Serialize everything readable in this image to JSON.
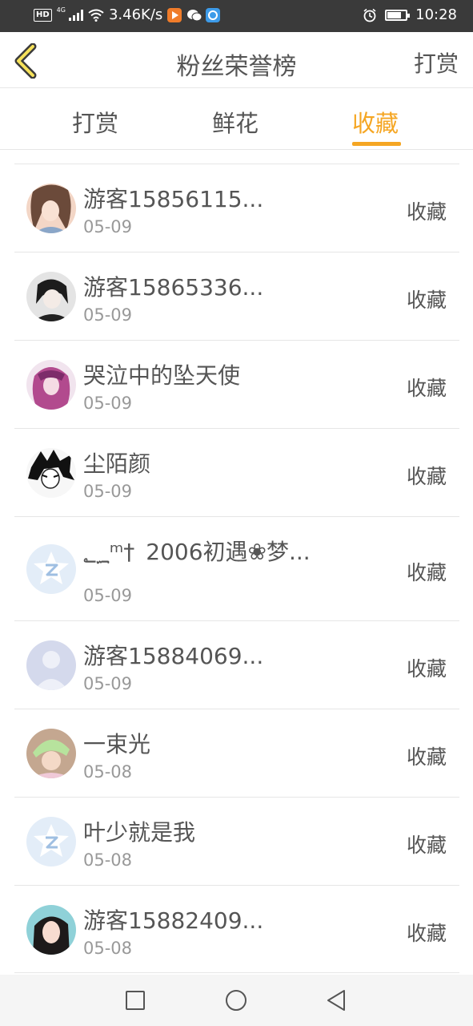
{
  "status_bar": {
    "hd": "HD",
    "network": "4G",
    "speed": "3.46K/s",
    "time": "10:28",
    "battery_level": 0.75
  },
  "header": {
    "back_icon": "chevron-left-icon",
    "title": "粉丝荣誉榜",
    "action_label": "打赏"
  },
  "tabs": [
    {
      "label": "打赏",
      "active": false
    },
    {
      "label": "鲜花",
      "active": false
    },
    {
      "label": "收藏",
      "active": true
    }
  ],
  "colors": {
    "accent": "#f5a623",
    "text": "#555555",
    "muted": "#999999",
    "status_bar": "#3a3a3a"
  },
  "list": [
    {
      "name": "游客15856115...",
      "date": "05-09",
      "action": "收藏",
      "avatar": "anime-girl-avatar"
    },
    {
      "name": "游客15865336...",
      "date": "05-09",
      "action": "收藏",
      "avatar": "anime-boy-avatar"
    },
    {
      "name": "哭泣中的坠天使",
      "date": "05-09",
      "action": "收藏",
      "avatar": "pink-hair-avatar"
    },
    {
      "name": "尘陌颜",
      "date": "05-09",
      "action": "收藏",
      "avatar": "sketch-boy-avatar"
    },
    {
      "name": "؂؁ᵐ† 2006初遇❀梦...",
      "date": "05-09",
      "action": "收藏",
      "avatar": "default-qq-avatar"
    },
    {
      "name": "游客15884069...",
      "date": "05-09",
      "action": "收藏",
      "avatar": "default-person-avatar"
    },
    {
      "name": "一束光",
      "date": "05-08",
      "action": "收藏",
      "avatar": "photo-avatar"
    },
    {
      "name": "叶少就是我",
      "date": "05-08",
      "action": "收藏",
      "avatar": "default-qq-avatar"
    },
    {
      "name": "游客15882409...",
      "date": "05-08",
      "action": "收藏",
      "avatar": "photo-woman-avatar"
    }
  ],
  "nav": {
    "recent_icon": "square-icon",
    "home_icon": "circle-icon",
    "back_icon": "triangle-back-icon"
  }
}
